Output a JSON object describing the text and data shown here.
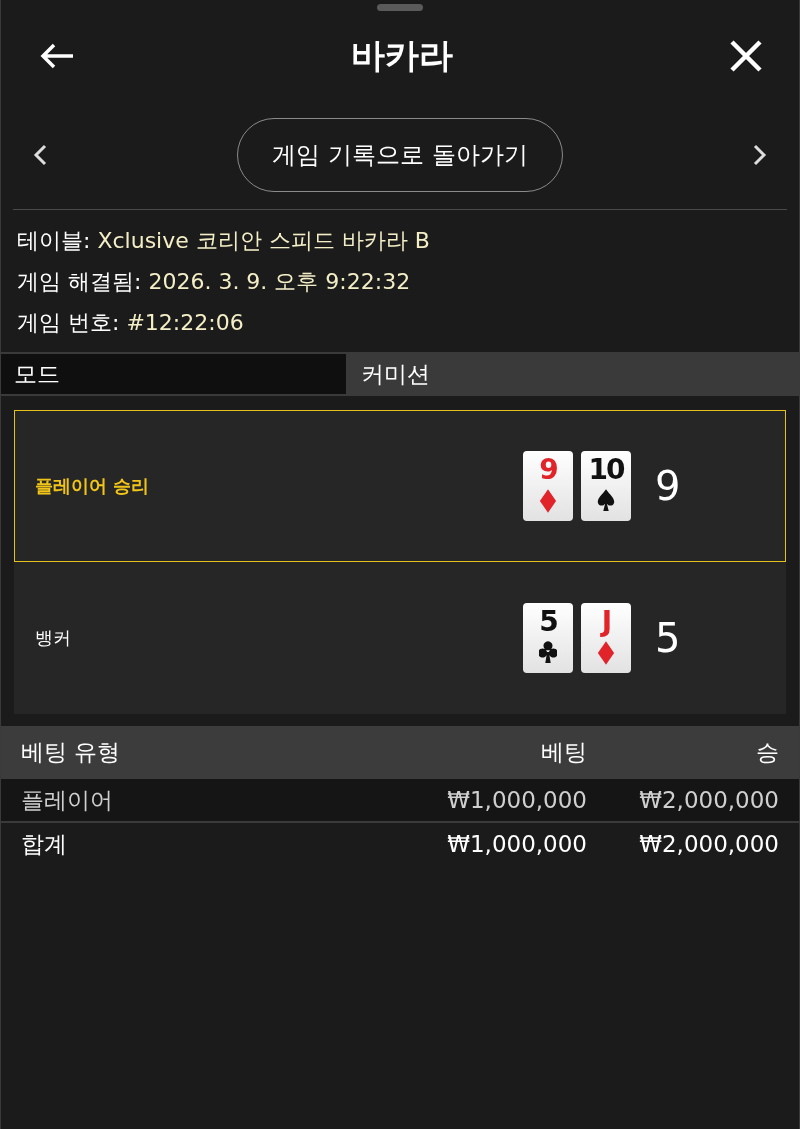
{
  "header": {
    "title": "바카라"
  },
  "nav": {
    "button": "게임 기록으로 돌아가기"
  },
  "info": [
    {
      "label": "테이블:",
      "value": "Xclusive 코리안 스피드 바카라 B"
    },
    {
      "label": "게임 해결됨:",
      "value": "2026. 3. 9. 오후 9:22:32"
    },
    {
      "label": "게임 번호:",
      "value": "#12:22:06"
    }
  ],
  "mode": {
    "label": "모드",
    "value": "커미션"
  },
  "hands": [
    {
      "name": "플레이어 승리",
      "winner": true,
      "cards": [
        {
          "rank": "9",
          "kind": "diamonds"
        },
        {
          "rank": "10",
          "kind": "spades"
        }
      ],
      "score": "9"
    },
    {
      "name": "뱅커",
      "winner": false,
      "cards": [
        {
          "rank": "5",
          "kind": "clubs"
        },
        {
          "rank": "J",
          "kind": "diamonds"
        }
      ],
      "score": "5"
    }
  ],
  "bets": {
    "columns": [
      "베팅 유형",
      "베팅",
      "승"
    ],
    "rows": [
      {
        "kind": "bet",
        "cells": [
          "플레이어",
          "₩1,000,000",
          "₩2,000,000"
        ]
      },
      {
        "kind": "total",
        "cells": [
          "합계",
          "₩1,000,000",
          "₩2,000,000"
        ]
      }
    ]
  }
}
